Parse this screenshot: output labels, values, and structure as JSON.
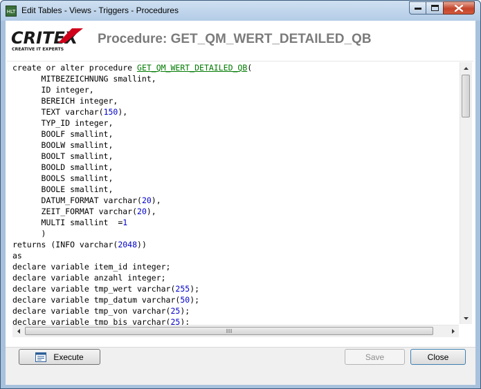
{
  "window": {
    "title": "Edit Tables - Views - Triggers - Procedures",
    "app_icon_text": "HLT"
  },
  "header": {
    "logo_text": "CRITEX",
    "logo_tagline": "CREATIVE IT EXPERTS",
    "title": "Procedure: GET_QM_WERT_DETAILED_QB"
  },
  "editor": {
    "lines": [
      [
        {
          "t": "create or alter procedure "
        },
        {
          "t": "GET_QM_WERT_DETAILED_QB",
          "k": "ident"
        },
        {
          "t": "("
        }
      ],
      [
        {
          "t": "      MITBEZEICHNUNG smallint,"
        }
      ],
      [
        {
          "t": "      ID integer,"
        }
      ],
      [
        {
          "t": "      BEREICH integer,"
        }
      ],
      [
        {
          "t": "      TEXT varchar("
        },
        {
          "t": "150",
          "k": "num"
        },
        {
          "t": "),"
        }
      ],
      [
        {
          "t": "      TYP_ID integer,"
        }
      ],
      [
        {
          "t": "      BOOLF smallint,"
        }
      ],
      [
        {
          "t": "      BOOLW smallint,"
        }
      ],
      [
        {
          "t": "      BOOLT smallint,"
        }
      ],
      [
        {
          "t": "      BOOLD smallint,"
        }
      ],
      [
        {
          "t": "      BOOLS smallint,"
        }
      ],
      [
        {
          "t": "      BOOLE smallint,"
        }
      ],
      [
        {
          "t": "      DATUM_FORMAT varchar("
        },
        {
          "t": "20",
          "k": "num"
        },
        {
          "t": "),"
        }
      ],
      [
        {
          "t": "      ZEIT_FORMAT varchar("
        },
        {
          "t": "20",
          "k": "num"
        },
        {
          "t": "),"
        }
      ],
      [
        {
          "t": "      MULTI smallint  ="
        },
        {
          "t": "1",
          "k": "num"
        }
      ],
      [
        {
          "t": "      )"
        }
      ],
      [
        {
          "t": "returns (INFO varchar("
        },
        {
          "t": "2048",
          "k": "num"
        },
        {
          "t": "))"
        }
      ],
      [
        {
          "t": "as"
        }
      ],
      [
        {
          "t": "declare variable item_id integer;"
        }
      ],
      [
        {
          "t": "declare variable anzahl integer;"
        }
      ],
      [
        {
          "t": "declare variable tmp_wert varchar("
        },
        {
          "t": "255",
          "k": "num"
        },
        {
          "t": ");"
        }
      ],
      [
        {
          "t": "declare variable tmp_datum varchar("
        },
        {
          "t": "50",
          "k": "num"
        },
        {
          "t": ");"
        }
      ],
      [
        {
          "t": "declare variable tmp_von varchar("
        },
        {
          "t": "25",
          "k": "num"
        },
        {
          "t": ");"
        }
      ],
      [
        {
          "t": "declare variable tmp_bis varchar("
        },
        {
          "t": "25",
          "k": "num"
        },
        {
          "t": ");"
        }
      ]
    ]
  },
  "footer": {
    "execute_label": "Execute",
    "save_label": "Save",
    "close_label": "Close"
  },
  "colors": {
    "keyword_number": "#0000c8",
    "identifier": "#007a00",
    "header_title": "#7b7b7b",
    "logo_red": "#d0021b"
  },
  "icons": {
    "execute": "execute-icon",
    "minimize": "minimize-icon",
    "maximize": "maximize-icon",
    "close": "close-icon"
  }
}
